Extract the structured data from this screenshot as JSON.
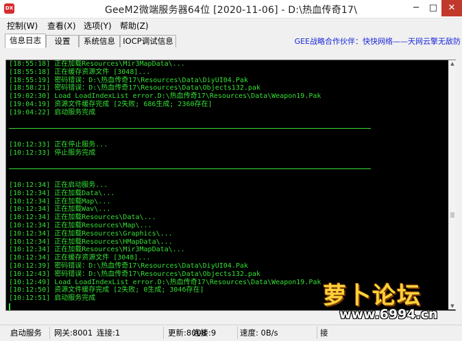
{
  "window": {
    "title": "GeeM2微端服务器64位 [2020-11-06] - D:\\热血传奇17\\",
    "icon_label": "DX",
    "controls": {
      "minimize": "─",
      "maximize": "□",
      "close": "✕"
    }
  },
  "menu": [
    "控制(W)",
    "查看(X)",
    "选项(Y)",
    "帮助(Z)"
  ],
  "tabs": [
    "信息日志",
    "设置",
    "系统信息",
    "IOCP调试信息"
  ],
  "active_tab": "信息日志",
  "partner_text": "GEE战略合作伙伴：快快网络——天网云擎无敌防",
  "log_lines": [
    "[18:55:18] 正在加载Resources\\Mir3MapData\\...",
    "[18:55:18] 正在缓存资源文件 [3048]...",
    "[18:55:19] 密码错误：D:\\热血传奇17\\Resources\\Data\\DiyUI04.Pak",
    "[18:58:21] 密码错误：D:\\热血传奇17\\Resources\\Data\\Objects132.pak",
    "[19:02:30] Load LoadIndexList error.D:\\热血传奇17\\Resources\\Data\\Weapon19.Pak",
    "[19:04:19] 资源文件缓存完成 [2失败; 686生成; 2360存在]",
    "[19:04:22] 启动服务完成",
    "",
    "---",
    "",
    "[10:12:33] 正在停止服务...",
    "[10:12:33] 停止服务完成",
    "",
    "---",
    "",
    "[10:12:34] 正在启动服务...",
    "[10:12:34] 正在加载Data\\...",
    "[10:12:34] 正在加载Map\\...",
    "[10:12:34] 正在加载Wav\\...",
    "[10:12:34] 正在加载Resources\\Data\\...",
    "[10:12:34] 正在加载Resources\\Map\\...",
    "[10:12:34] 正在加载Resources\\Graphics\\...",
    "[10:12:34] 正在加载Resources\\HMapData\\...",
    "[10:12:34] 正在加载Resources\\Mir3MapData\\...",
    "[10:12:34] 正在缓存资源文件 [3048]...",
    "[10:12:39] 密码错误：D:\\热血传奇17\\Resources\\Data\\DiyUI04.Pak",
    "[10:12:43] 密码错误：D:\\热血传奇17\\Resources\\Data\\Objects132.pak",
    "[10:12:49] Load LoadIndexList error.D:\\热血传奇17\\Resources\\Data\\Weapon19.Pak",
    "[10:12:50] 资源文件缓存完成 [2失败; 0生成; 3046存在]",
    "[10:12:51] 启动服务完成"
  ],
  "status": {
    "service_button": "启动服务",
    "gateway": "网关:8001",
    "gateway_conn": "连接:1",
    "update": "更新:8008",
    "update_conn": "连接:9",
    "speed": "速度: 0B/s",
    "extra": "接"
  },
  "watermark": {
    "logo": "萝卜论坛",
    "url": "www.6994.cn"
  },
  "colors": {
    "log_text": "#35e035",
    "log_bg": "#000000",
    "partner": "#1a27d8"
  }
}
